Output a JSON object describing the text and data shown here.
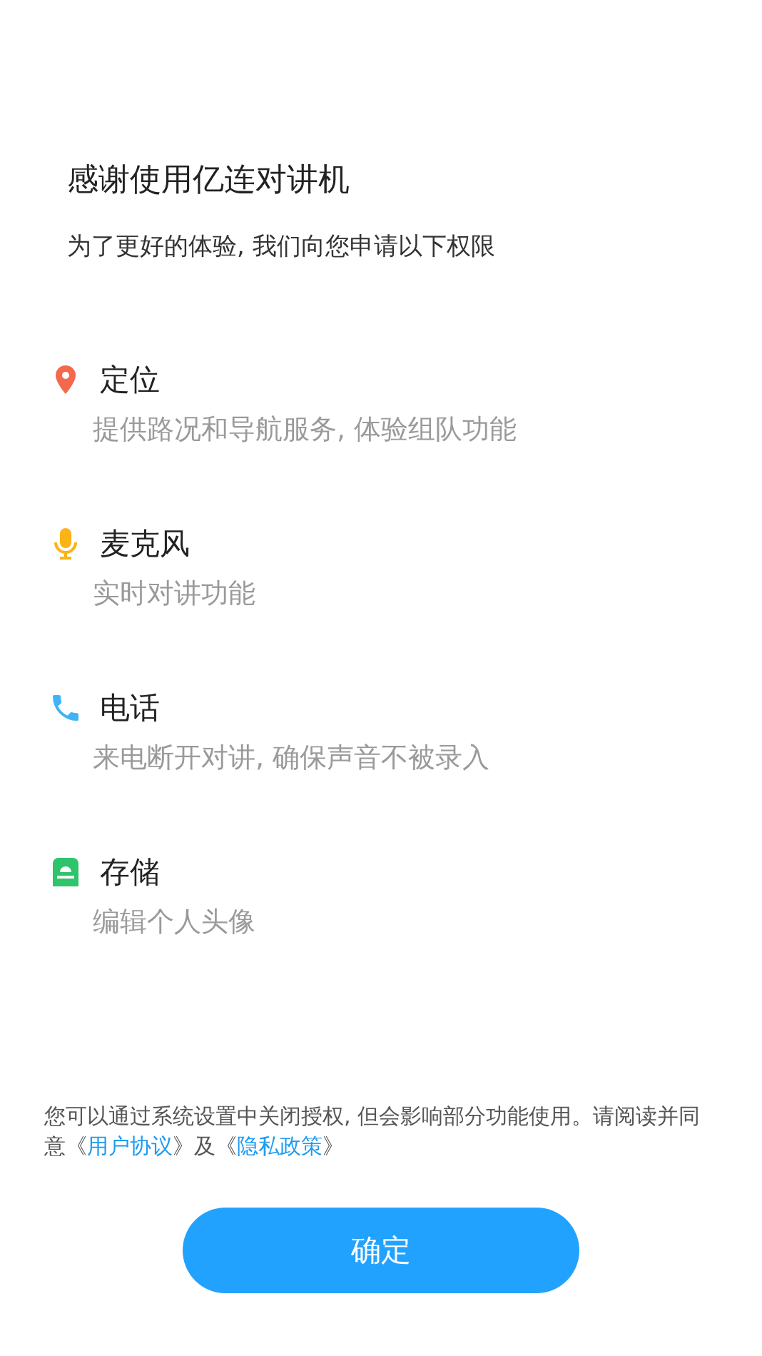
{
  "title": "感谢使用亿连对讲机",
  "subtitle": "为了更好的体验, 我们向您申请以下权限",
  "permissions": [
    {
      "kind": "location",
      "color": "#f4694b",
      "name": "定位",
      "description": "提供路况和导航服务, 体验组队功能"
    },
    {
      "kind": "microphone",
      "color": "#fbb316",
      "name": "麦克风",
      "description": "实时对讲功能"
    },
    {
      "kind": "phone",
      "color": "#3fb3f6",
      "name": "电话",
      "description": "来电断开对讲, 确保声音不被录入"
    },
    {
      "kind": "storage",
      "color": "#2ec46b",
      "name": "存储",
      "description": "编辑个人头像"
    }
  ],
  "notice": [
    {
      "kind": "text",
      "text": "您可以通过系统设置中关闭授权, 但会影响部分功能使用。请阅读并同意《"
    },
    {
      "kind": "link",
      "text": "用户协议"
    },
    {
      "kind": "text",
      "text": "》及《"
    },
    {
      "kind": "link",
      "text": "隐私政策"
    },
    {
      "kind": "text",
      "text": "》"
    }
  ],
  "confirm_button": "确定"
}
